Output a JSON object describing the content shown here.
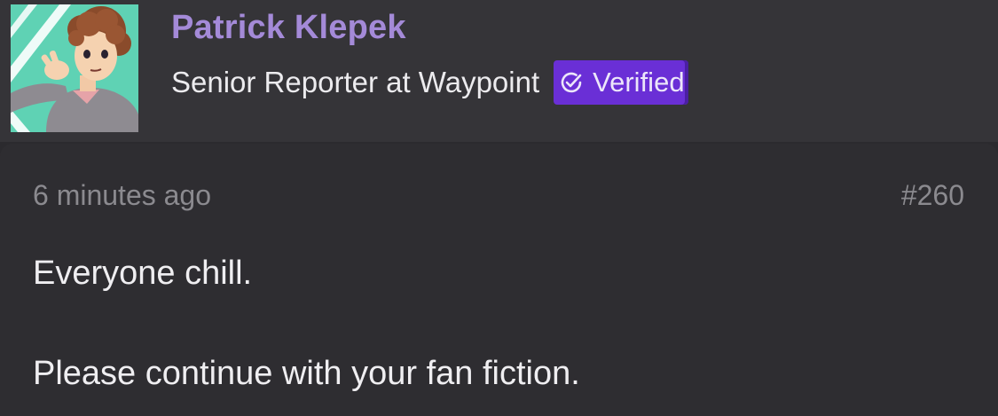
{
  "author": {
    "name": "Patrick Klepek",
    "role": "Senior Reporter at Waypoint",
    "badge_label": "Verified",
    "name_color": "#a48ad8",
    "badge_color": "#6a2fd6",
    "avatar_icon": "cartoon-portrait-avatar"
  },
  "post": {
    "timestamp": "6 minutes ago",
    "number": "#260",
    "paragraphs": [
      "Everyone chill.",
      "Please continue with your fan fiction."
    ]
  }
}
